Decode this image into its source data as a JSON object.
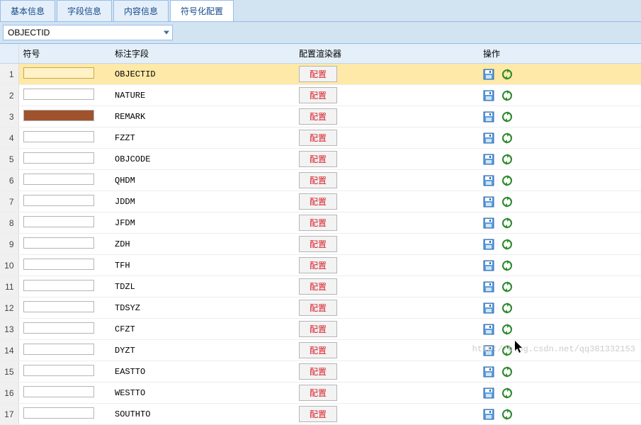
{
  "tabs": [
    {
      "label": "基本信息",
      "active": false
    },
    {
      "label": "字段信息",
      "active": false
    },
    {
      "label": "内容信息",
      "active": false
    },
    {
      "label": "符号化配置",
      "active": true
    }
  ],
  "dropdown": {
    "value": "OBJECTID"
  },
  "columns": {
    "num": "",
    "symbol": "符号",
    "label": "标注字段",
    "renderer": "配置渲染器",
    "action": "操作"
  },
  "config_button_label": "配置",
  "rows": [
    {
      "n": "1",
      "label": "OBJECTID",
      "selected": true,
      "color": "yellow"
    },
    {
      "n": "2",
      "label": "NATURE",
      "selected": false,
      "color": ""
    },
    {
      "n": "3",
      "label": "REMARK",
      "selected": false,
      "color": "brown"
    },
    {
      "n": "4",
      "label": "FZZT",
      "selected": false,
      "color": ""
    },
    {
      "n": "5",
      "label": "OBJCODE",
      "selected": false,
      "color": ""
    },
    {
      "n": "6",
      "label": "QHDM",
      "selected": false,
      "color": ""
    },
    {
      "n": "7",
      "label": "JDDM",
      "selected": false,
      "color": ""
    },
    {
      "n": "8",
      "label": "JFDM",
      "selected": false,
      "color": ""
    },
    {
      "n": "9",
      "label": "ZDH",
      "selected": false,
      "color": ""
    },
    {
      "n": "10",
      "label": "TFH",
      "selected": false,
      "color": ""
    },
    {
      "n": "11",
      "label": "TDZL",
      "selected": false,
      "color": ""
    },
    {
      "n": "12",
      "label": "TDSYZ",
      "selected": false,
      "color": ""
    },
    {
      "n": "13",
      "label": "CFZT",
      "selected": false,
      "color": ""
    },
    {
      "n": "14",
      "label": "DYZT",
      "selected": false,
      "color": ""
    },
    {
      "n": "15",
      "label": "EASTTO",
      "selected": false,
      "color": ""
    },
    {
      "n": "16",
      "label": "WESTTO",
      "selected": false,
      "color": ""
    },
    {
      "n": "17",
      "label": "SOUTHTO",
      "selected": false,
      "color": ""
    }
  ],
  "watermark": "http://blog.csdn.net/qq381332153"
}
